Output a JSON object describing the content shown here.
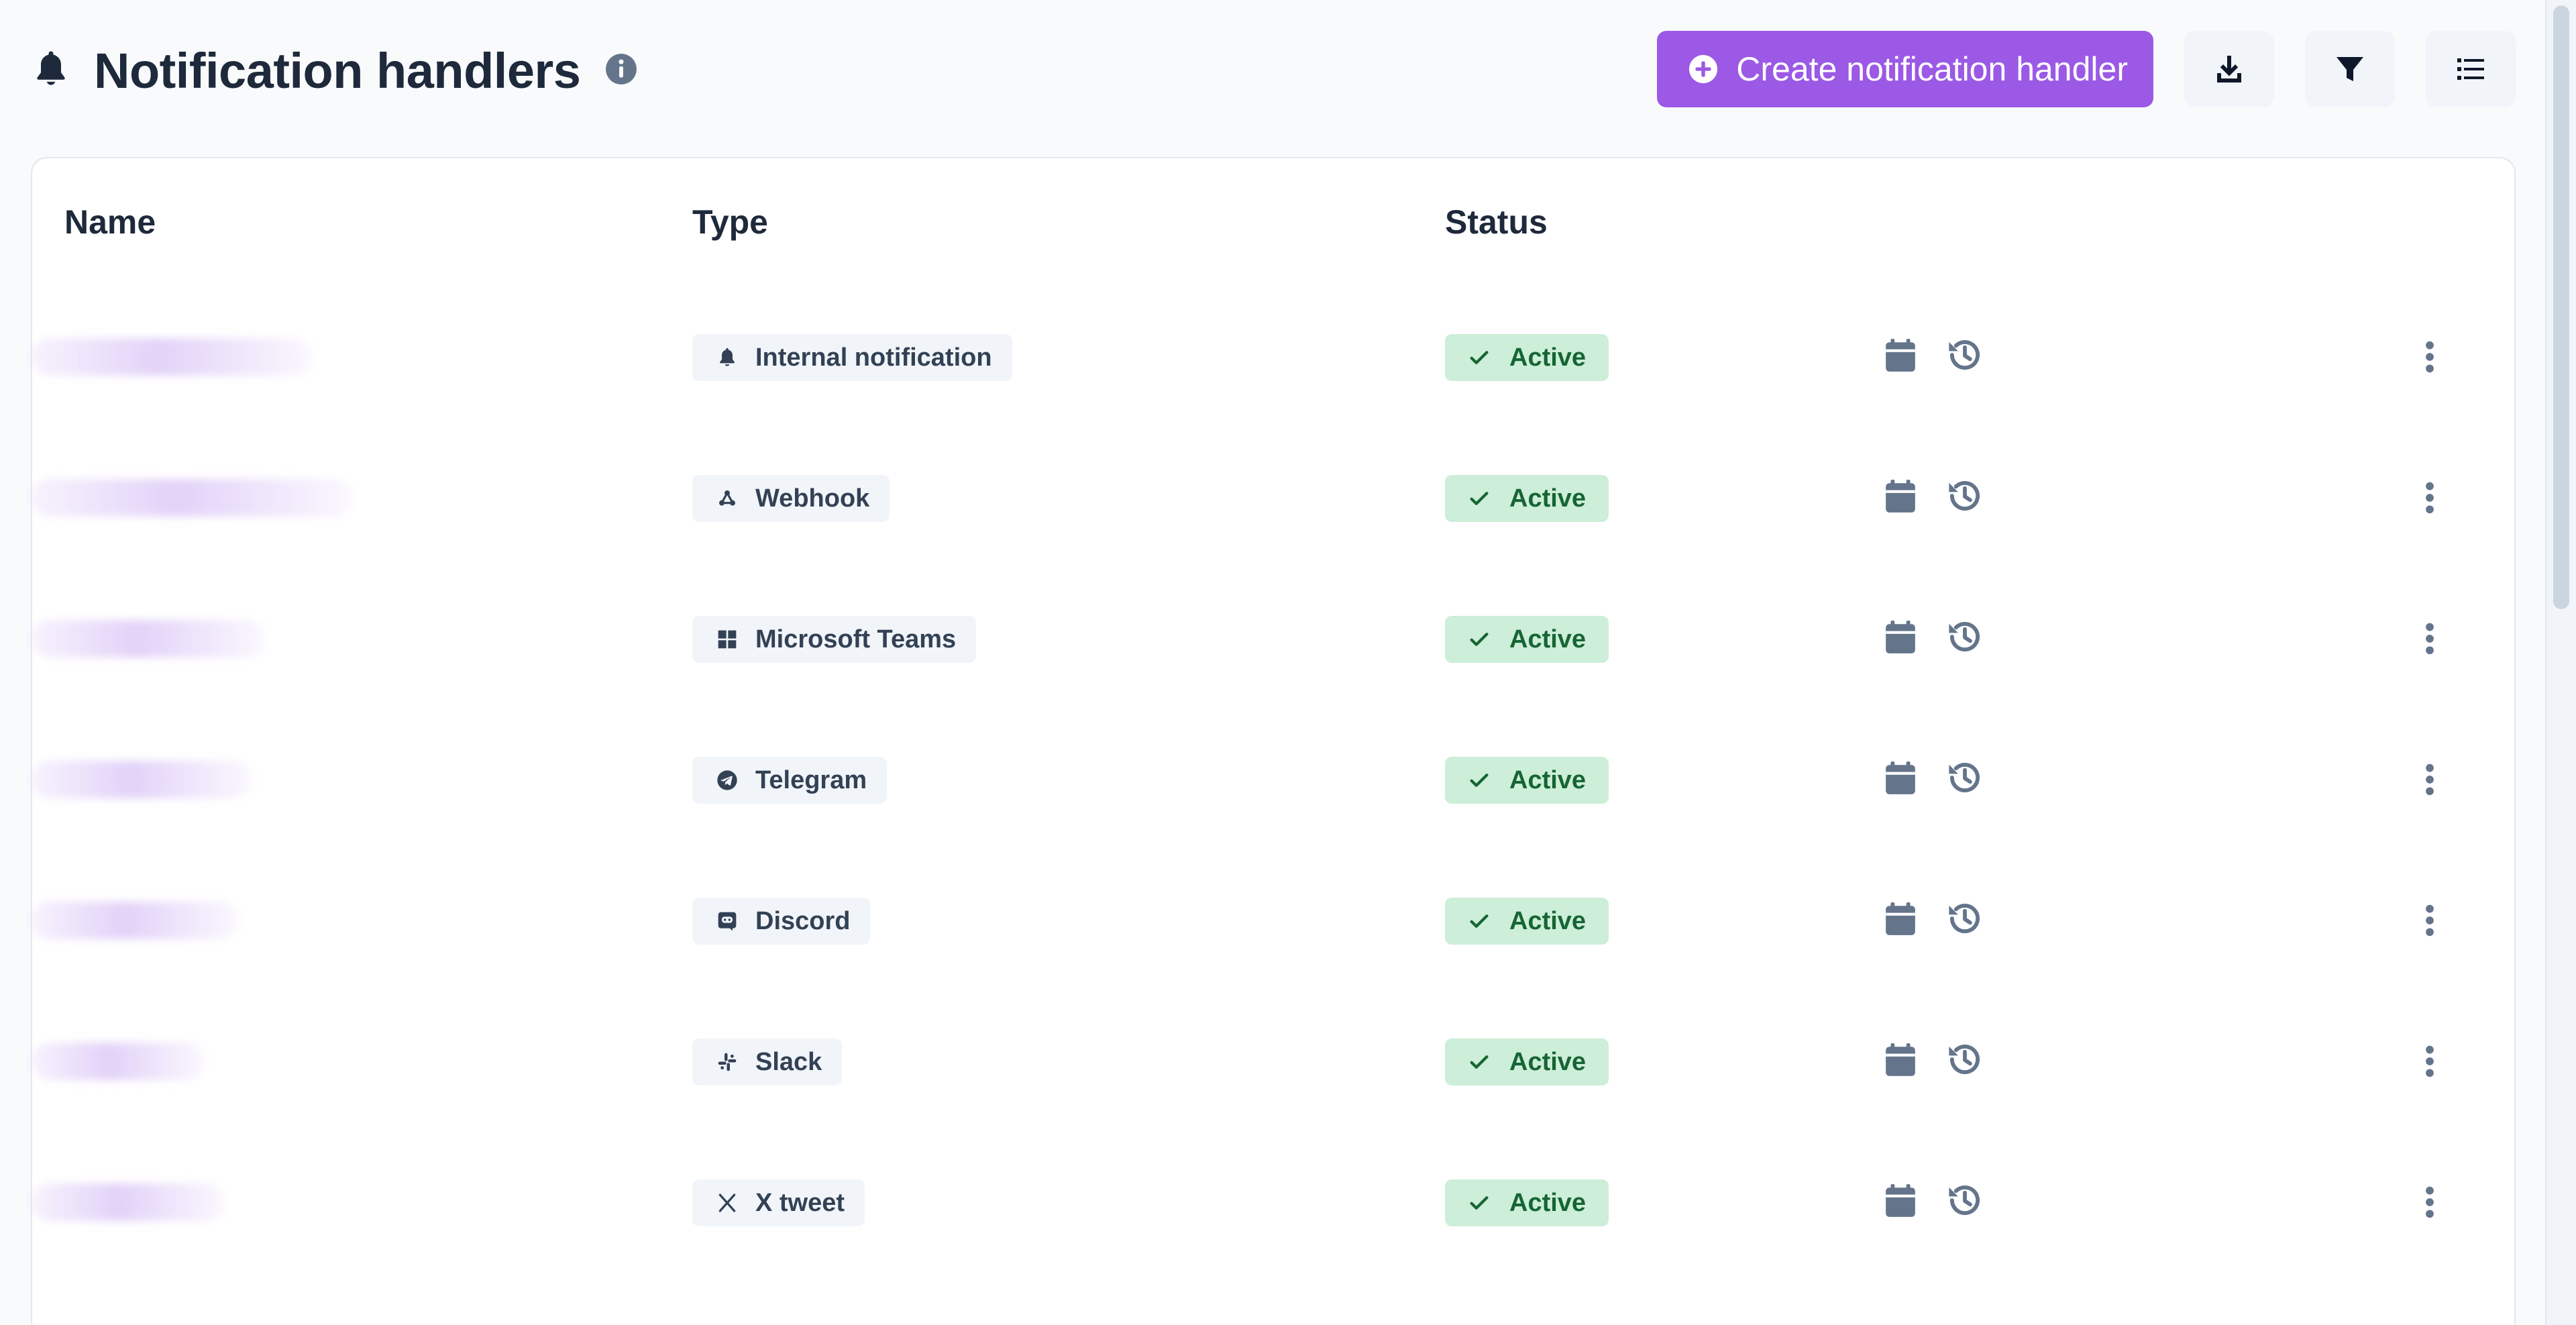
{
  "header": {
    "title": "Notification handlers",
    "create_label": "Create notification handler"
  },
  "table": {
    "columns": {
      "name": "Name",
      "type": "Type",
      "status": "Status"
    },
    "rows": [
      {
        "type": "Internal notification",
        "type_icon": "bell-icon",
        "status": "Active"
      },
      {
        "type": "Webhook",
        "type_icon": "webhook-icon",
        "status": "Active"
      },
      {
        "type": "Microsoft Teams",
        "type_icon": "windows-icon",
        "status": "Active"
      },
      {
        "type": "Telegram",
        "type_icon": "telegram-icon",
        "status": "Active"
      },
      {
        "type": "Discord",
        "type_icon": "discord-icon",
        "status": "Active"
      },
      {
        "type": "Slack",
        "type_icon": "slack-icon",
        "status": "Active"
      },
      {
        "type": "X tweet",
        "type_icon": "x-icon",
        "status": "Active"
      }
    ]
  },
  "colors": {
    "accent": "#9b59e6",
    "status_bg": "#cdeed8",
    "status_text": "#166534",
    "badge_bg": "#f1f5f9",
    "icon_gray": "#64748b"
  }
}
